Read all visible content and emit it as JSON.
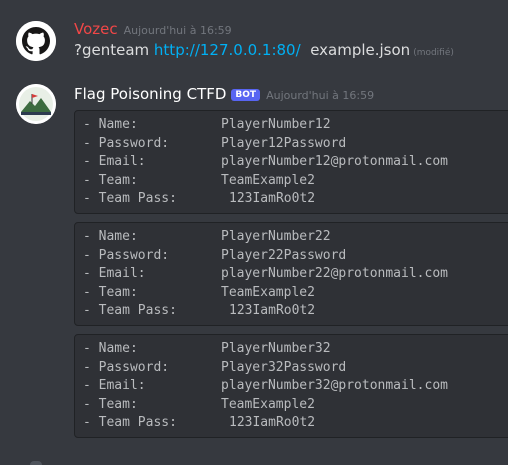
{
  "messages": [
    {
      "author": "Vozec",
      "author_color": "#f04747",
      "timestamp": "Aujourd'hui à 16:59",
      "command": "?genteam",
      "link": "http://127.0.0.1:80/",
      "file": "example.json",
      "edited": "(modifié)"
    },
    {
      "author": "Flag Poisoning CTFD",
      "author_color": "#ffffff",
      "bot_tag": "BOT",
      "timestamp": "Aujourd'hui à 16:59",
      "blocks": [
        {
          "name_label": "- Name:",
          "name": "PlayerNumber12",
          "password_label": "- Password:",
          "password": "Player12Password",
          "email_label": "- Email:",
          "email": "playerNumber12@protonmail.com",
          "team_label": "- Team:",
          "team": "TeamExample2",
          "team_pass_label": "- Team Pass:",
          "team_pass": "123IamRo0t2"
        },
        {
          "name_label": "- Name:",
          "name": "PlayerNumber22",
          "password_label": "- Password:",
          "password": "Player22Password",
          "email_label": "- Email:",
          "email": "playerNumber22@protonmail.com",
          "team_label": "- Team:",
          "team": "TeamExample2",
          "team_pass_label": "- Team Pass:",
          "team_pass": "123IamRo0t2"
        },
        {
          "name_label": "- Name:",
          "name": "PlayerNumber32",
          "password_label": "- Password:",
          "password": "Player32Password",
          "email_label": "- Email:",
          "email": "playerNumber32@protonmail.com",
          "team_label": "- Team:",
          "team": "TeamExample2",
          "team_pass_label": "- Team Pass:",
          "team_pass": "123IamRo0t2"
        }
      ]
    }
  ],
  "icons": {
    "user_avatar": "github-octocat-icon",
    "bot_avatar": "ctf-flag-mountain-icon"
  }
}
